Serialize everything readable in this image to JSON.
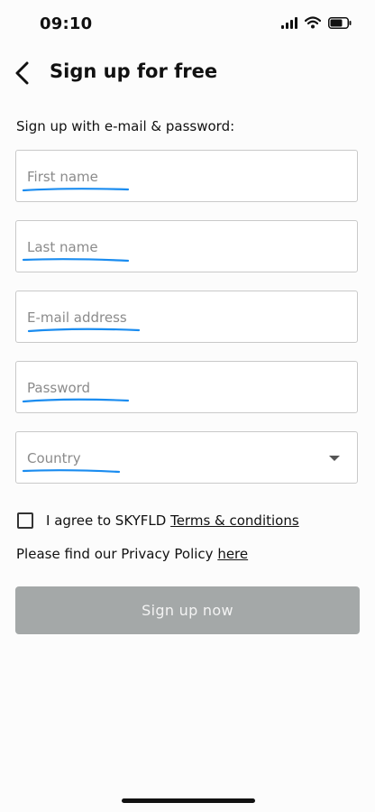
{
  "status_bar": {
    "time": "09:10"
  },
  "header": {
    "title": "Sign up for free",
    "back_icon": "chevron-left-icon"
  },
  "form": {
    "subtitle": "Sign up with e-mail & password:",
    "fields": [
      {
        "placeholder": "First name"
      },
      {
        "placeholder": "Last name"
      },
      {
        "placeholder": "E-mail address"
      },
      {
        "placeholder": "Password"
      },
      {
        "placeholder": "Country",
        "type": "dropdown"
      }
    ],
    "annotation_color": "#1a8cf0"
  },
  "terms": {
    "prefix": "I agree to SKYFLD ",
    "link": "Terms & conditions",
    "checked": false
  },
  "privacy": {
    "prefix": "Please find our Privacy Policy ",
    "link": "here"
  },
  "submit": {
    "label": "Sign up now",
    "color": "#a4a8a8"
  }
}
